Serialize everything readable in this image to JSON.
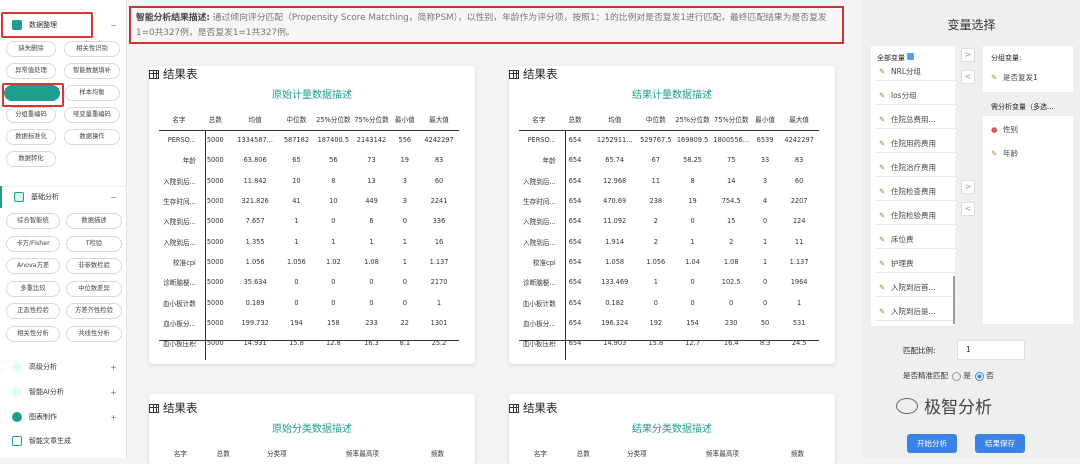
{
  "sidebar": {
    "data_section": "数据整理",
    "data_items": [
      "缺失删除",
      "相关性识别",
      "异常值处理",
      "智能数据填补",
      "",
      "样本均衡",
      "分组重编码",
      "哑变量重编码",
      "数据标准化",
      "数据操作",
      "数据转化"
    ],
    "basic_section": "基础分析",
    "basic_items": [
      "综合智能统",
      "数据描述",
      "卡方/Fisher",
      "T检验",
      "Anova方差",
      "非参数检验",
      "多重比较",
      "中位数差异",
      "正态性检验",
      "方差齐性检验",
      "相关性分析",
      "共线性分析"
    ],
    "advanced": "高级分析",
    "ai": "智能AI分析",
    "chart": "图表制作",
    "report": "智能文章生成",
    "arrow_minus": "−",
    "arrow_plus": "+",
    "accent": "#1f9e8e"
  },
  "desc": {
    "label": "智能分析结果描述:",
    "text": "通过倾向评分匹配（Propensity Score Matching，简称PSM），以性别，年龄作为评分项，按照1：1的比例对是否复发1进行匹配，最终匹配结果为是否复发1=0共327例，是否复发1=1共327例。"
  },
  "result_title": "结果表",
  "tables": [
    {
      "subtitle": "原始计量数据描述",
      "headers": [
        "名字",
        "总数",
        "均值",
        "中位数",
        "25%分位数",
        "75%分位数",
        "最小值",
        "最大值"
      ],
      "rows": [
        [
          "PERSO...",
          "5000",
          "1334587...",
          "587182",
          "187400.5",
          "2143142",
          "556",
          "4242297"
        ],
        [
          "年龄",
          "5000",
          "63.806",
          "65",
          "56",
          "73",
          "19",
          "83"
        ],
        [
          "入院到后...",
          "5000",
          "11.842",
          "10",
          "8",
          "13",
          "3",
          "60"
        ],
        [
          "生存时间...",
          "5000",
          "321.826",
          "41",
          "10",
          "449",
          "3",
          "2241"
        ],
        [
          "入院到后...",
          "5000",
          "7.657",
          "1",
          "0",
          "6",
          "0",
          "336"
        ],
        [
          "入院到后...",
          "5000",
          "1.355",
          "1",
          "1",
          "1",
          "1",
          "16"
        ],
        [
          "校准cpi",
          "5000",
          "1.056",
          "1.056",
          "1.02",
          "1.08",
          "1",
          "1.137"
        ],
        [
          "诊断脑梗...",
          "5000",
          "35.634",
          "0",
          "0",
          "0",
          "0",
          "2170"
        ],
        [
          "血小板计数",
          "5000",
          "0.189",
          "0",
          "0",
          "0",
          "0",
          "1"
        ],
        [
          "血小板分...",
          "5000",
          "199.732",
          "194",
          "158",
          "233",
          "22",
          "1301"
        ],
        [
          "血小板压积",
          "5000",
          "14.931",
          "15.8",
          "12.8",
          "16.3",
          "8.1",
          "25.2"
        ]
      ]
    },
    {
      "subtitle": "结果计量数据描述",
      "headers": [
        "名字",
        "总数",
        "均值",
        "中位数",
        "25%分位数",
        "75%分位数",
        "最小值",
        "最大值"
      ],
      "rows": [
        [
          "PERSO...",
          "654",
          "1252911...",
          "529767.5",
          "169809.5",
          "1800556...",
          "6539",
          "4242297"
        ],
        [
          "年龄",
          "654",
          "65.74",
          "67",
          "58.25",
          "75",
          "33",
          "83"
        ],
        [
          "入院到后...",
          "654",
          "12.968",
          "11",
          "8",
          "14",
          "3",
          "60"
        ],
        [
          "生存时间...",
          "654",
          "470.69",
          "238",
          "19",
          "754.5",
          "4",
          "2207"
        ],
        [
          "入院到后...",
          "654",
          "11.092",
          "2",
          "0",
          "15",
          "0",
          "124"
        ],
        [
          "入院到后...",
          "654",
          "1.914",
          "2",
          "1",
          "2",
          "1",
          "11"
        ],
        [
          "校准cpi",
          "654",
          "1.058",
          "1.056",
          "1.04",
          "1.08",
          "1",
          "1.137"
        ],
        [
          "诊断脑梗...",
          "654",
          "133.469",
          "1",
          "0",
          "102.5",
          "0",
          "1964"
        ],
        [
          "血小板计数",
          "654",
          "0.182",
          "0",
          "0",
          "0",
          "0",
          "1"
        ],
        [
          "血小板分...",
          "654",
          "196.324",
          "192",
          "154",
          "230",
          "50",
          "531"
        ],
        [
          "血小板压积",
          "654",
          "14.903",
          "15.8",
          "12.7",
          "16.4",
          "8.3",
          "24.5"
        ]
      ]
    }
  ],
  "bottom_tables": [
    {
      "subtitle": "原始分类数据描述",
      "headers": [
        "名字",
        "总数",
        "分类项",
        "频率最高项",
        "频数"
      ]
    },
    {
      "subtitle": "结果分类数据描述",
      "headers": [
        "名字",
        "总数",
        "分类项",
        "频率最高项",
        "频数"
      ]
    }
  ],
  "right": {
    "title": "变量选择",
    "all_vars_label": "全部变量",
    "all_vars": [
      "NRL分组",
      "los分组",
      "住院总费用...",
      "住院用药费用",
      "住院治疗费用",
      "住院检查费用",
      "住院检验费用",
      "床位费",
      "护理费",
      "入院到后首...",
      "入院到后是..."
    ],
    "group_label": "分组变量:",
    "group_vars": [
      "是否复发1"
    ],
    "need_label": "需分析变量（多选...",
    "need_vars": [
      "性别",
      "年龄"
    ],
    "ratio_label": "匹配比例:",
    "ratio_value": "1",
    "exact_label": "是否精准匹配",
    "yes": "是",
    "no": "否",
    "start_btn": "开始分析",
    "save_btn": "结果保存",
    "move_right": ">",
    "move_left": "<",
    "btn_color": "#3b82e6"
  },
  "watermark": "极智分析"
}
